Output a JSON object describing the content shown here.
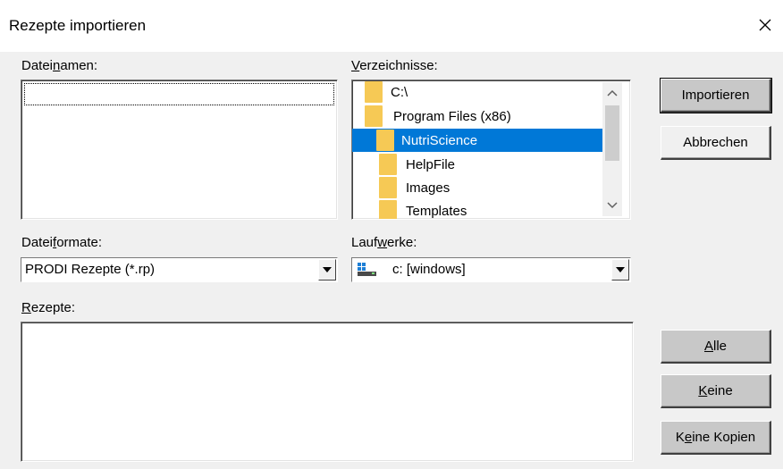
{
  "dialog": {
    "title": "Rezepte importieren",
    "close_glyph": "✕"
  },
  "labels": {
    "dateinamen_pre": "Datei",
    "dateinamen_u": "n",
    "dateinamen_post": "amen:",
    "verzeichnisse_pre": "",
    "verzeichnisse_u": "V",
    "verzeichnisse_post": "erzeichnisse:",
    "dateiformate_pre": "Datei",
    "dateiformate_u": "f",
    "dateiformate_post": "ormate:",
    "laufwerke_pre": "Lauf",
    "laufwerke_u": "w",
    "laufwerke_post": "erke:",
    "rezepte_pre": "",
    "rezepte_u": "R",
    "rezepte_post": "ezepte:"
  },
  "directories": [
    {
      "label": "C:\\",
      "selected": false,
      "icon": "folder-open-icon"
    },
    {
      "label": "Program Files (x86)",
      "selected": false,
      "icon": "folder-open-icon"
    },
    {
      "label": "NutriScience",
      "selected": true,
      "icon": "folder-open-icon"
    },
    {
      "label": "HelpFile",
      "selected": false,
      "icon": "folder-icon"
    },
    {
      "label": "Images",
      "selected": false,
      "icon": "folder-icon"
    },
    {
      "label": "Templates",
      "selected": false,
      "icon": "folder-icon"
    }
  ],
  "dateiformat_value": "PRODI Rezepte (*.rp)",
  "laufwerk_value": "c: [windows]",
  "buttons": {
    "importieren": "Importieren",
    "abbrechen": "Abbrechen",
    "alle_u": "A",
    "alle_post": "lle",
    "keine_u": "K",
    "keine_post": "eine",
    "keine_kopien_pre": "K",
    "keine_kopien_u": "e",
    "keine_kopien_post": "ine Kopien"
  },
  "colors": {
    "selection": "#0078d7",
    "folder": "#f6c955",
    "dialog_bg": "#f0f0f0"
  }
}
